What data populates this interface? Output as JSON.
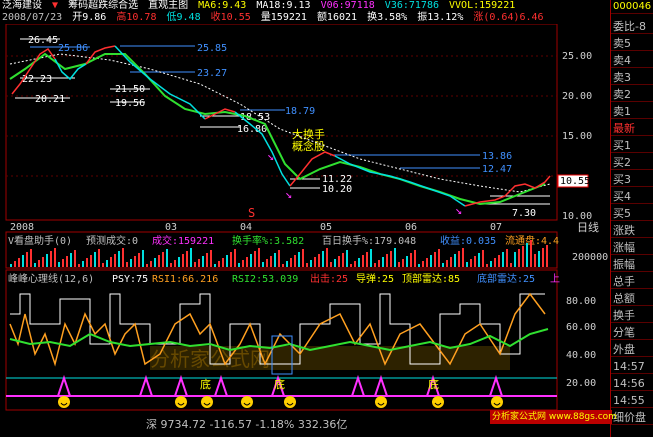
{
  "header": {
    "stock_name": "泛海建设",
    "indicator_name": "筹码超跌综合选",
    "view_mode": "直观主图",
    "ma6": "MA6:9.43",
    "ma18": "MA18:9.13",
    "v06": "V06:97118",
    "v36": "V36:71786",
    "vvol": "VVOL:159221",
    "date": "2008/07/23",
    "open": "开9.86",
    "high": "高10.78",
    "low": "低9.48",
    "close": "收10.55",
    "vol": "量159221",
    "amount": "额16021",
    "turnover": "换3.58%",
    "amplitude": "振13.12%",
    "change": "涨(0.64)6.46"
  },
  "main_chart": {
    "y_ticks": [
      "25.00",
      "20.00",
      "15.00",
      "10.00"
    ],
    "current_price": "10.55",
    "x_ticks": [
      "2008",
      "03",
      "04",
      "05",
      "06",
      "07"
    ],
    "right_axis_label": "日线",
    "price_annotations": [
      "26.45",
      "25.86",
      "25.85",
      "23.27",
      "22.23",
      "21.50",
      "20.21",
      "19.56",
      "18.79",
      "18.53",
      "16.80",
      "13.86",
      "12.47",
      "11.22",
      "10.20",
      "7.30"
    ],
    "annotation_text": [
      "大换手",
      "概念股"
    ],
    "s_marker": "S"
  },
  "volume_panel": {
    "title": "V看盘助手(0)",
    "predict": "预测成交:0",
    "vol_label": "成交:159221",
    "turnover_label": "换手率%:3.582",
    "hundred_day": "百日换手%:179.048",
    "earnings": "收益:0.035",
    "float": "流通盘:4.4",
    "y_tick": "200000"
  },
  "psych_panel": {
    "title": "峰峰心理线(12,6)",
    "psy": "PSY:75",
    "rsi1": "RSI1:66.216",
    "rsi2": "RSI2:53.039",
    "out": "出击:25",
    "missile": "导弹:25",
    "top_radar": "顶部雷达:85",
    "bottom_radar": "底部雷达:25",
    "extra": "上",
    "y_ticks": [
      "80.00",
      "60.00",
      "40.00",
      "20.00"
    ],
    "bottom_labels": [
      "底",
      "底",
      "底"
    ],
    "watermark": "分析家公式网"
  },
  "status_bar": {
    "index_text": "深 9734.72 -116.57 -1.18% 332.36亿"
  },
  "brand": {
    "name": "分析家公式网 www.88gs.com",
    "url": "www.88gs.com"
  },
  "right_panel": {
    "code": "000046",
    "items": [
      "委比-8",
      "卖5",
      "卖4",
      "卖3",
      "卖2",
      "卖1",
      "最新",
      "买1",
      "买2",
      "买3",
      "买4",
      "买5",
      "涨跌",
      "涨幅",
      "振幅",
      "总手",
      "总额",
      "换手",
      "分笔",
      "外盘",
      "14:57",
      "14:56",
      "14:55",
      "细价盘"
    ]
  },
  "colors": {
    "up": "#ff3030",
    "down": "#00e0e0",
    "ma_short": "#ffffff",
    "ma_long": "#ffff00",
    "line_green": "#30e030",
    "line_orange": "#ffa020",
    "line_magenta": "#ff30ff",
    "accent_blue": "#4090ff"
  },
  "chart_data": [
    {
      "type": "line",
      "title": "泛海建设",
      "x": [
        "2008",
        "03",
        "04",
        "05",
        "06",
        "07"
      ],
      "series": [
        {
          "name": "MA6",
          "values": [
            26.0,
            24.5,
            21.0,
            18.0,
            14.0,
            11.5,
            12.0,
            12.8,
            11.0,
            9.43
          ]
        },
        {
          "name": "MA18",
          "values": [
            24.0,
            23.5,
            22.0,
            19.5,
            16.0,
            13.5,
            12.8,
            12.0,
            11.5,
            9.13
          ]
        }
      ],
      "ylim": [
        7,
        27
      ]
    },
    {
      "type": "line",
      "title": "峰峰心理线",
      "series": [
        {
          "name": "PSY",
          "values": [
            75
          ]
        },
        {
          "name": "RSI1",
          "values": [
            66.216
          ]
        },
        {
          "name": "RSI2",
          "values": [
            53.039
          ]
        }
      ],
      "ylim": [
        10,
        90
      ]
    }
  ]
}
